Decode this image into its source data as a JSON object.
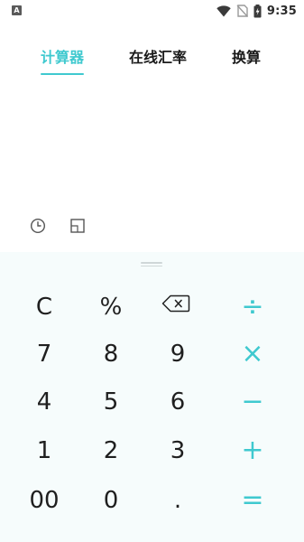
{
  "status_bar": {
    "app_badge": "A",
    "time": "9:35"
  },
  "tabs": [
    {
      "label": "计算器",
      "active": true
    },
    {
      "label": "在线汇率",
      "active": false
    },
    {
      "label": "换算",
      "active": false
    }
  ],
  "display": {
    "expression": "",
    "result": ""
  },
  "tools": {
    "history_icon": "clock-icon",
    "layout_icon": "layout-icon"
  },
  "keypad": {
    "rows": [
      [
        "C",
        "%",
        "backspace",
        "÷"
      ],
      [
        "7",
        "8",
        "9",
        "×"
      ],
      [
        "4",
        "5",
        "6",
        "−"
      ],
      [
        "1",
        "2",
        "3",
        "+"
      ],
      [
        "00",
        "0",
        ".",
        "="
      ]
    ]
  },
  "colors": {
    "accent": "#3fc9cf",
    "keypad_bg": "#f6fcfc",
    "text": "#1f1f1f"
  }
}
